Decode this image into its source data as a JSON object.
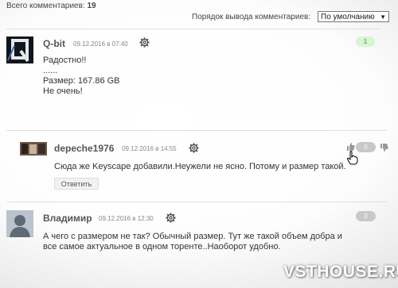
{
  "summary": {
    "label": "Всего комментариев:",
    "count": "19"
  },
  "sort": {
    "label": "Порядок вывода комментариев:",
    "selected": "По умолчанию"
  },
  "comments": [
    {
      "author": "Q-bit",
      "date": "09.12.2016 в 07:40",
      "lines": [
        "Радостно!!",
        "......",
        "Размер: 167.86 GB",
        "Не очень!"
      ],
      "rating": "1"
    },
    {
      "author": "depeche1976",
      "date": "09.12.2016 в 14:55",
      "lines": [
        "Сюда же Keyscape добавили.Неужели не ясно. Потому и размер такой."
      ],
      "rating": "0",
      "reply_label": "Ответить"
    },
    {
      "author": "Владимир",
      "date": "09.12.2016 в 12:30",
      "lines": [
        "А чего с размером не так? Обычный размер. Тут же такой объем добра и",
        "все самое актуальное в одном торенте..Наоборот удобно."
      ],
      "rating": "0"
    }
  ],
  "watermark": "VSTHOUSE.RU",
  "colors": {
    "positive_badge_bg": "#d9f5d4",
    "positive_badge_fg": "#3b8b34",
    "neutral_badge_bg": "#c8c8c8"
  }
}
